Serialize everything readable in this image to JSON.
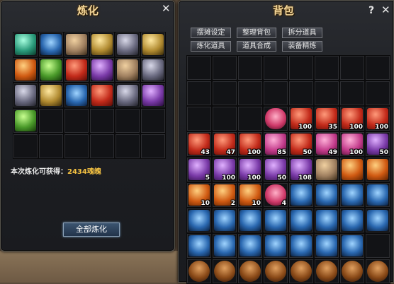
{
  "refine": {
    "title": "炼化",
    "gain_label": "本次炼化可获得：",
    "gain_value": "2434魂魄",
    "button": "全部炼化",
    "slots": [
      {
        "icon": "green-armor-icon",
        "color": "c-teal"
      },
      {
        "icon": "blue-armor-icon",
        "color": "c-blue"
      },
      {
        "icon": "helmet-icon",
        "color": "c-tan"
      },
      {
        "icon": "gold-armor-icon",
        "color": "c-gold"
      },
      {
        "icon": "silver-disc-icon",
        "color": "c-gray"
      },
      {
        "icon": "ring-icon",
        "color": "c-gold"
      },
      {
        "icon": "gem-ring-icon",
        "color": "c-orange"
      },
      {
        "icon": "pouch-icon",
        "color": "c-green"
      },
      {
        "icon": "red-robe-icon",
        "color": "c-red"
      },
      {
        "icon": "purple-robe-icon",
        "color": "c-purp"
      },
      {
        "icon": "bow-icon",
        "color": "c-tan"
      },
      {
        "icon": "black-armor-icon",
        "color": "c-gray"
      },
      {
        "icon": "gray-helmet-icon",
        "color": "c-gray"
      },
      {
        "icon": "wand-icon",
        "color": "c-gold"
      },
      {
        "icon": "staff-icon",
        "color": "c-blue"
      },
      {
        "icon": "red-helmet-icon",
        "color": "c-red"
      },
      {
        "icon": "white-orb-icon",
        "color": "c-gray"
      },
      {
        "icon": "talisman-icon",
        "color": "c-purp"
      },
      {
        "icon": "jade-pendant-icon",
        "color": "c-green"
      },
      null,
      null,
      null,
      null,
      null,
      null,
      null,
      null,
      null,
      null,
      null
    ]
  },
  "bag": {
    "title": "背包",
    "help": "?",
    "buttons": [
      "摆摊设定",
      "整理背包",
      "拆分道具",
      "炼化道具",
      "道具合成",
      "装备精炼"
    ],
    "slots": [
      null,
      null,
      null,
      null,
      null,
      null,
      null,
      null,
      null,
      null,
      null,
      null,
      null,
      null,
      null,
      null,
      null,
      null,
      null,
      {
        "icon": "flower-bouquet-icon",
        "color": "c-rose"
      },
      {
        "icon": "red-bottle-icon",
        "color": "c-red",
        "count": "100"
      },
      {
        "icon": "red-bottle-icon",
        "color": "c-red",
        "count": "35"
      },
      {
        "icon": "red-bottle-icon",
        "color": "c-red",
        "count": "100"
      },
      {
        "icon": "red-bottle-icon",
        "color": "c-red",
        "count": "100"
      },
      {
        "icon": "red-bottle-icon",
        "color": "c-red",
        "count": "43"
      },
      {
        "icon": "red-bottle-icon",
        "color": "c-red",
        "count": "47"
      },
      {
        "icon": "red-bottle-icon",
        "color": "c-red",
        "count": "100"
      },
      {
        "icon": "pink-bottle-icon",
        "color": "c-pink",
        "count": "85"
      },
      {
        "icon": "red-bottle-icon",
        "color": "c-red",
        "count": "50"
      },
      {
        "icon": "pink-bottle-icon",
        "color": "c-pink",
        "count": "49"
      },
      {
        "icon": "pink-bottle-icon",
        "color": "c-pink",
        "count": "100"
      },
      {
        "icon": "purple-bottle-icon",
        "color": "c-purp",
        "count": "50"
      },
      {
        "icon": "purple-bottle-icon",
        "color": "c-purp",
        "count": "5"
      },
      {
        "icon": "purple-bottle-icon",
        "color": "c-purp",
        "count": "100"
      },
      {
        "icon": "purple-bottle-icon",
        "color": "c-purp",
        "count": "100"
      },
      {
        "icon": "purple-bottle-icon",
        "color": "c-purp",
        "count": "50"
      },
      {
        "icon": "purple-bottle-icon",
        "color": "c-purp",
        "count": "108"
      },
      {
        "icon": "scroll-icon",
        "color": "c-tan"
      },
      {
        "icon": "orange-scroll-icon",
        "color": "c-orange"
      },
      {
        "icon": "orange-scroll-icon",
        "color": "c-orange"
      },
      {
        "icon": "orange-scroll-icon",
        "color": "c-orange",
        "count": "10"
      },
      {
        "icon": "orange-scroll-icon",
        "color": "c-orange",
        "count": "2"
      },
      {
        "icon": "orange-scroll-icon",
        "color": "c-orange",
        "count": "10"
      },
      {
        "icon": "rose-icon",
        "color": "c-rose",
        "count": "4"
      },
      {
        "icon": "blue-rune-icon",
        "color": "c-blue"
      },
      {
        "icon": "blue-rune-icon",
        "color": "c-blue"
      },
      {
        "icon": "blue-rune-icon",
        "color": "c-blue"
      },
      {
        "icon": "blue-rune-icon",
        "color": "c-blue"
      },
      {
        "icon": "blue-rune-icon",
        "color": "c-blue"
      },
      {
        "icon": "blue-rune-icon",
        "color": "c-blue"
      },
      {
        "icon": "blue-rune-icon",
        "color": "c-blue"
      },
      {
        "icon": "blue-rune-icon",
        "color": "c-blue"
      },
      {
        "icon": "blue-rune-icon",
        "color": "c-blue"
      },
      {
        "icon": "blue-rune-icon",
        "color": "c-blue"
      },
      {
        "icon": "blue-rune-icon",
        "color": "c-blue"
      },
      {
        "icon": "blue-rune-icon",
        "color": "c-blue"
      },
      {
        "icon": "blue-rune-icon",
        "color": "c-blue"
      },
      {
        "icon": "blue-rune-icon",
        "color": "c-blue"
      },
      {
        "icon": "blue-rune-icon",
        "color": "c-blue"
      },
      {
        "icon": "blue-rune-icon",
        "color": "c-blue"
      },
      {
        "icon": "blue-rune-icon",
        "color": "c-blue"
      },
      {
        "icon": "blue-rune-icon",
        "color": "c-blue"
      },
      {
        "icon": "blue-rune-icon",
        "color": "c-blue"
      },
      null,
      {
        "icon": "bronze-coin-icon",
        "color": "c-bronze"
      },
      {
        "icon": "bronze-coin-icon",
        "color": "c-bronze"
      },
      {
        "icon": "bronze-coin-icon",
        "color": "c-bronze"
      },
      {
        "icon": "bronze-coin-icon",
        "color": "c-bronze"
      },
      {
        "icon": "bronze-coin-icon",
        "color": "c-bronze"
      },
      {
        "icon": "bronze-coin-icon",
        "color": "c-bronze"
      },
      {
        "icon": "bronze-coin-icon",
        "color": "c-bronze"
      },
      {
        "icon": "bronze-coin-icon",
        "color": "c-bronze"
      }
    ]
  }
}
